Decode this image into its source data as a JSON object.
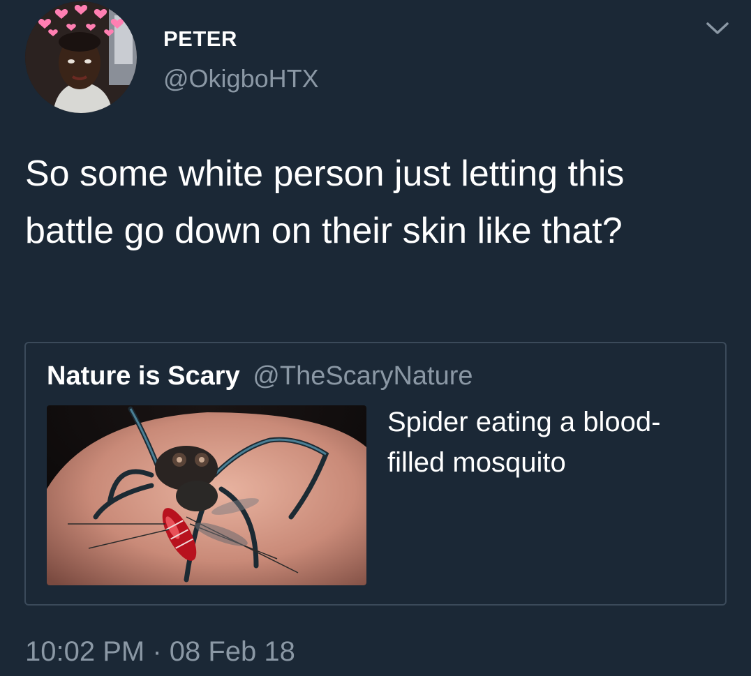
{
  "user": {
    "display_name": "PETER",
    "handle": "@OkigboHTX",
    "avatar_icon": "profile-photo-with-heart-crown"
  },
  "menu": {
    "icon": "chevron-down-icon"
  },
  "tweet": {
    "text": "So some white person just letting this battle go down on their skin like that?",
    "timestamp": "10:02 PM · 08 Feb 18"
  },
  "quoted_tweet": {
    "display_name": "Nature is Scary",
    "handle": "@TheScaryNature",
    "text": "Spider eating a blood-filled mosquito",
    "image_icon": "spider-eating-mosquito-photo"
  },
  "colors": {
    "background": "#1b2836",
    "primary_text": "#ffffff",
    "secondary_text": "#8b98a5",
    "border": "#3b4a5a"
  }
}
